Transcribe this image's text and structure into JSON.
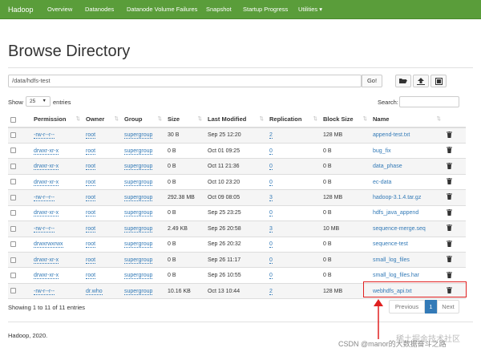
{
  "navbar": {
    "brand": "Hadoop",
    "items": [
      "Overview",
      "Datanodes",
      "Datanode Volume Failures",
      "Snapshot",
      "Startup Progress"
    ],
    "utilities": "Utilities ▾",
    "color": "#5a9d3a"
  },
  "page_title": "Browse Directory",
  "path": {
    "value": "/data/hdfs-test",
    "go_label": "Go!"
  },
  "toolbar_icons": [
    "folder-open-icon",
    "upload-icon",
    "cut-icon"
  ],
  "show": {
    "label_before": "Show",
    "value": "25",
    "label_after": "entries"
  },
  "search": {
    "label": "Search:"
  },
  "table": {
    "columns": [
      "Permission",
      "Owner",
      "Group",
      "Size",
      "Last Modified",
      "Replication",
      "Block Size",
      "Name"
    ],
    "rows": [
      {
        "permission": "-rw-r--r--",
        "owner": "root",
        "group": "supergroup",
        "size": "30 B",
        "modified": "Sep 25 12:20",
        "replication": "2",
        "block_size": "128 MB",
        "name": "append-test.txt"
      },
      {
        "permission": "drwxr-xr-x",
        "owner": "root",
        "group": "supergroup",
        "size": "0 B",
        "modified": "Oct 01 09:25",
        "replication": "0",
        "block_size": "0 B",
        "name": "bug_fix"
      },
      {
        "permission": "drwxr-xr-x",
        "owner": "root",
        "group": "supergroup",
        "size": "0 B",
        "modified": "Oct 11 21:36",
        "replication": "0",
        "block_size": "0 B",
        "name": "data_phase"
      },
      {
        "permission": "drwxr-xr-x",
        "owner": "root",
        "group": "supergroup",
        "size": "0 B",
        "modified": "Oct 10 23:20",
        "replication": "0",
        "block_size": "0 B",
        "name": "ec-data"
      },
      {
        "permission": "-rw-r--r--",
        "owner": "root",
        "group": "supergroup",
        "size": "292.38 MB",
        "modified": "Oct 09 08:05",
        "replication": "3",
        "block_size": "128 MB",
        "name": "hadoop-3.1.4.tar.gz"
      },
      {
        "permission": "drwxr-xr-x",
        "owner": "root",
        "group": "supergroup",
        "size": "0 B",
        "modified": "Sep 25 23:25",
        "replication": "0",
        "block_size": "0 B",
        "name": "hdfs_java_append"
      },
      {
        "permission": "-rw-r--r--",
        "owner": "root",
        "group": "supergroup",
        "size": "2.49 KB",
        "modified": "Sep 26 20:58",
        "replication": "3",
        "block_size": "10 MB",
        "name": "sequence-merge.seq"
      },
      {
        "permission": "drwxrwxrwx",
        "owner": "root",
        "group": "supergroup",
        "size": "0 B",
        "modified": "Sep 26 20:32",
        "replication": "0",
        "block_size": "0 B",
        "name": "sequence-test"
      },
      {
        "permission": "drwxr-xr-x",
        "owner": "root",
        "group": "supergroup",
        "size": "0 B",
        "modified": "Sep 26 11:17",
        "replication": "0",
        "block_size": "0 B",
        "name": "small_log_files"
      },
      {
        "permission": "drwxr-xr-x",
        "owner": "root",
        "group": "supergroup",
        "size": "0 B",
        "modified": "Sep 26 10:55",
        "replication": "0",
        "block_size": "0 B",
        "name": "small_log_files.har"
      },
      {
        "permission": "-rw-r--r--",
        "owner": "dr.who",
        "group": "supergroup",
        "size": "10.16 KB",
        "modified": "Oct 13 10:44",
        "replication": "2",
        "block_size": "128 MB",
        "name": "webhdfs_api.txt"
      }
    ]
  },
  "entries_info": "Showing 1 to 11 of 11 entries",
  "pagination": {
    "previous": "Previous",
    "current": "1",
    "next": "Next"
  },
  "footer": "Hadoop, 2020.",
  "watermark": "CSDN @manor的大数据奋斗之路",
  "watermark_bg": "稀土掘金技术社区",
  "annotation_color": "#e02020"
}
